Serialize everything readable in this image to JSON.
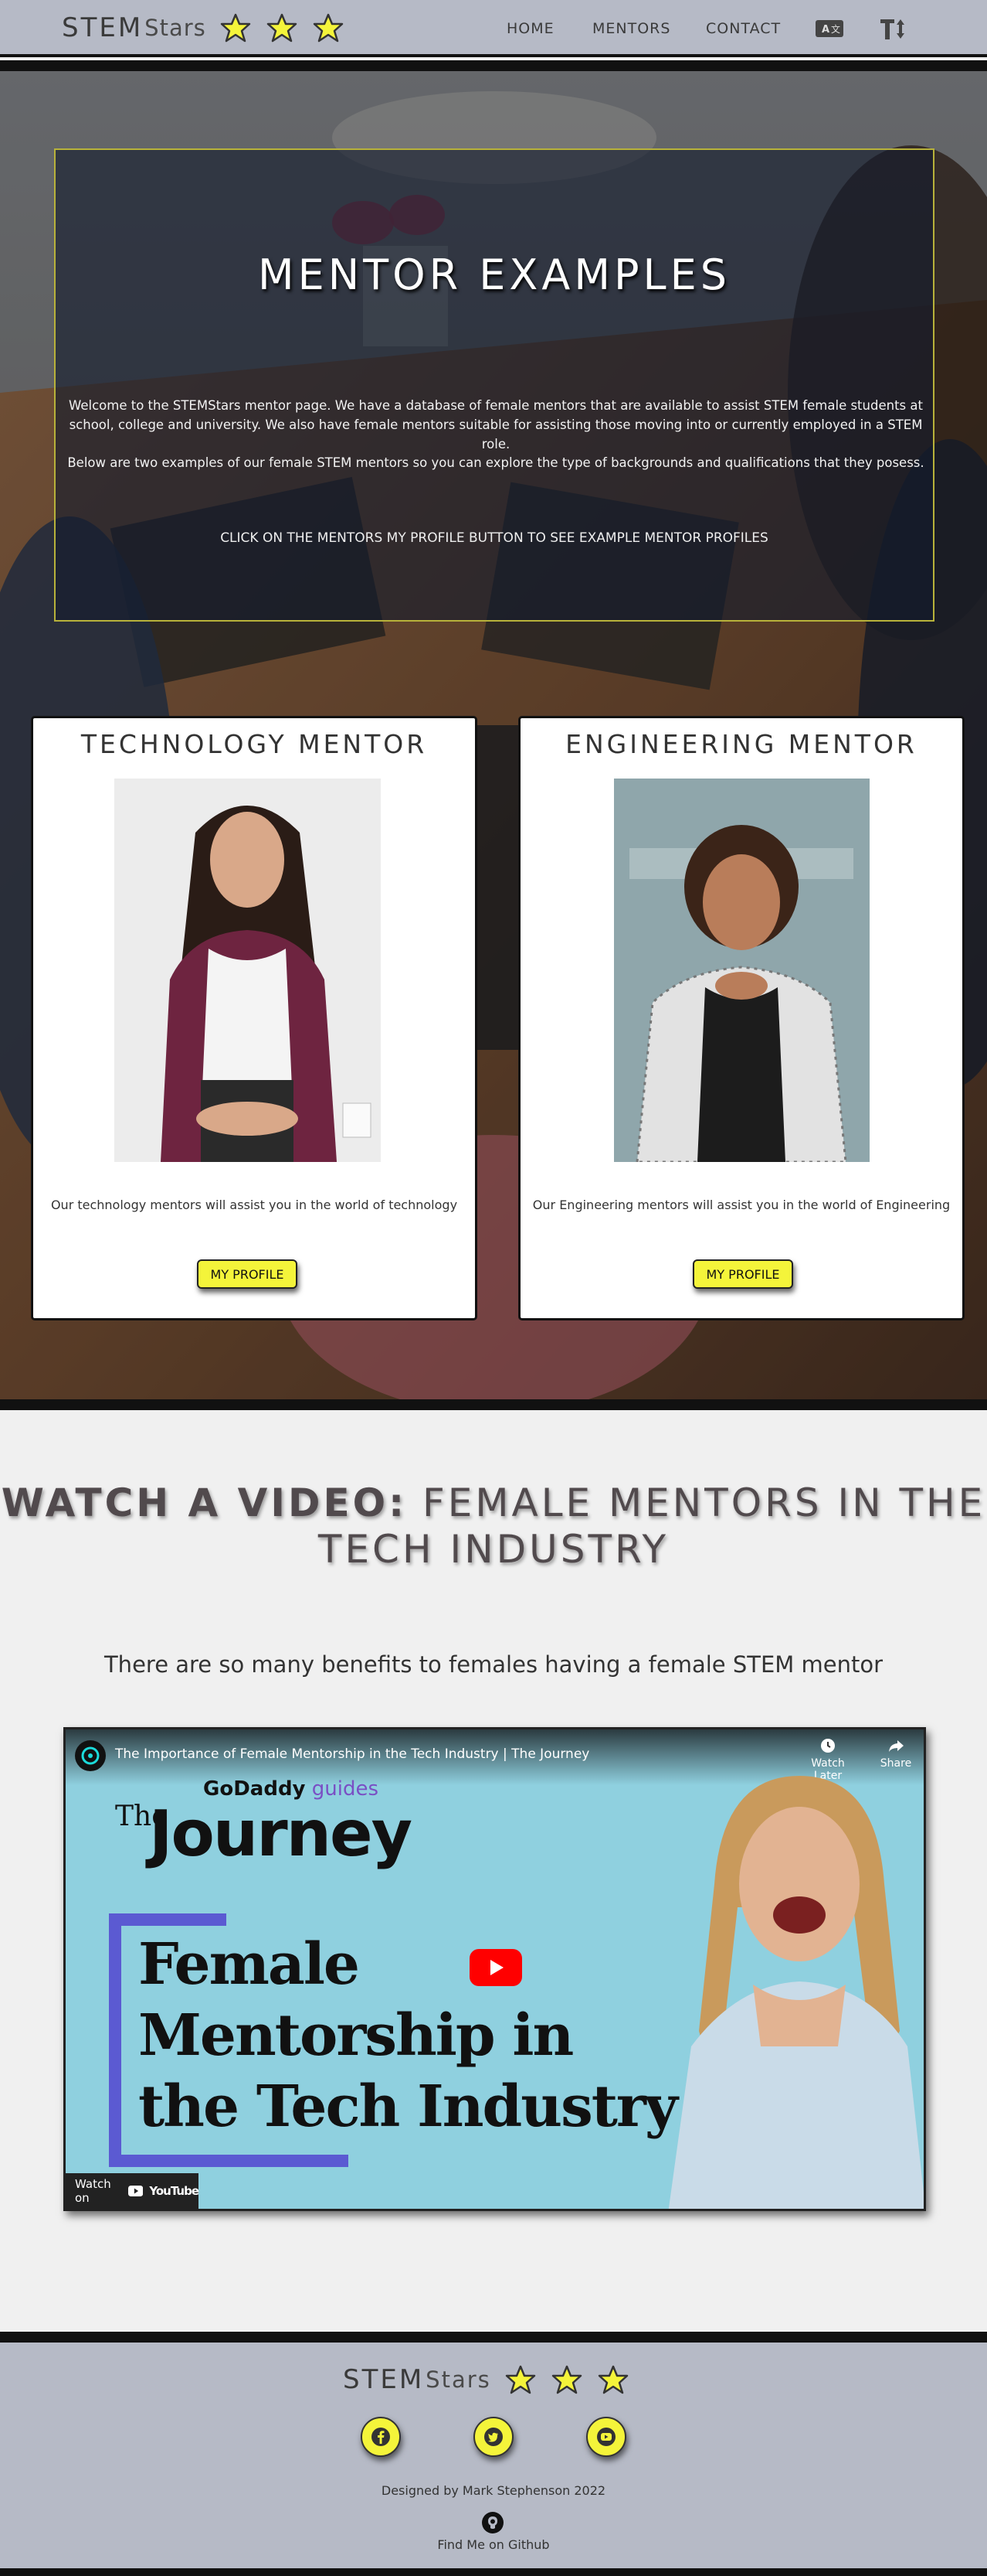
{
  "brand": {
    "stem": "STEM",
    "stars_word": "Stars",
    "star_count": 3
  },
  "nav": {
    "links": [
      {
        "label": "HOME"
      },
      {
        "label": "MENTORS"
      },
      {
        "label": "CONTACT"
      }
    ],
    "icons": [
      "translate-icon",
      "text-size-icon"
    ]
  },
  "hero": {
    "title": "MENTOR EXAMPLES",
    "paragraph1": "Welcome to the STEMStars mentor page. We have a database of female mentors that are available to assist STEM female students at school, college and university. We also have female mentors suitable for assisting those moving into or currently employed in a STEM role.",
    "paragraph2": "Below are two examples of our female STEM mentors so you can explore the type of backgrounds and qualifications that they posess.",
    "cta": "CLICK ON THE MENTORS MY PROFILE BUTTON TO SEE EXAMPLE MENTOR PROFILES"
  },
  "cards": [
    {
      "title": "TECHNOLOGY MENTOR",
      "text": "Our technology mentors will assist you in the world of technology",
      "button": "MY PROFILE"
    },
    {
      "title": "ENGINEERING MENTOR",
      "text": "Our Engineering mentors will assist you in the world of Engineering",
      "button": "MY PROFILE"
    }
  ],
  "video_section": {
    "title_bold": "WATCH A VIDEO:",
    "title_rest": " FEMALE MENTORS IN THE TECH INDUSTRY",
    "subtitle": "There are so many benefits to females having a female STEM mentor",
    "video": {
      "name": "The Importance of Female Mentorship in the Tech Industry | The Journey",
      "watch_later": "Watch Later",
      "share": "Share",
      "godaddy": "GoDaddy",
      "guides": " guides",
      "the": "The",
      "journey": "Journey",
      "headline": [
        "Female",
        "Mentorship in",
        "the Tech Industry"
      ],
      "watch_on": "Watch on",
      "youtube": "YouTube"
    }
  },
  "footer": {
    "stem": "STEM",
    "stars_word": "Stars",
    "social": [
      "facebook-icon",
      "twitter-icon",
      "youtube-icon"
    ],
    "designed": "Designed by Mark Stephenson 2022",
    "github": "Find Me on Github"
  },
  "colors": {
    "nav_bg": "#b6bac6",
    "accent": "#f4f43a",
    "border": "#111111",
    "section_bg": "#f0f0f0"
  }
}
